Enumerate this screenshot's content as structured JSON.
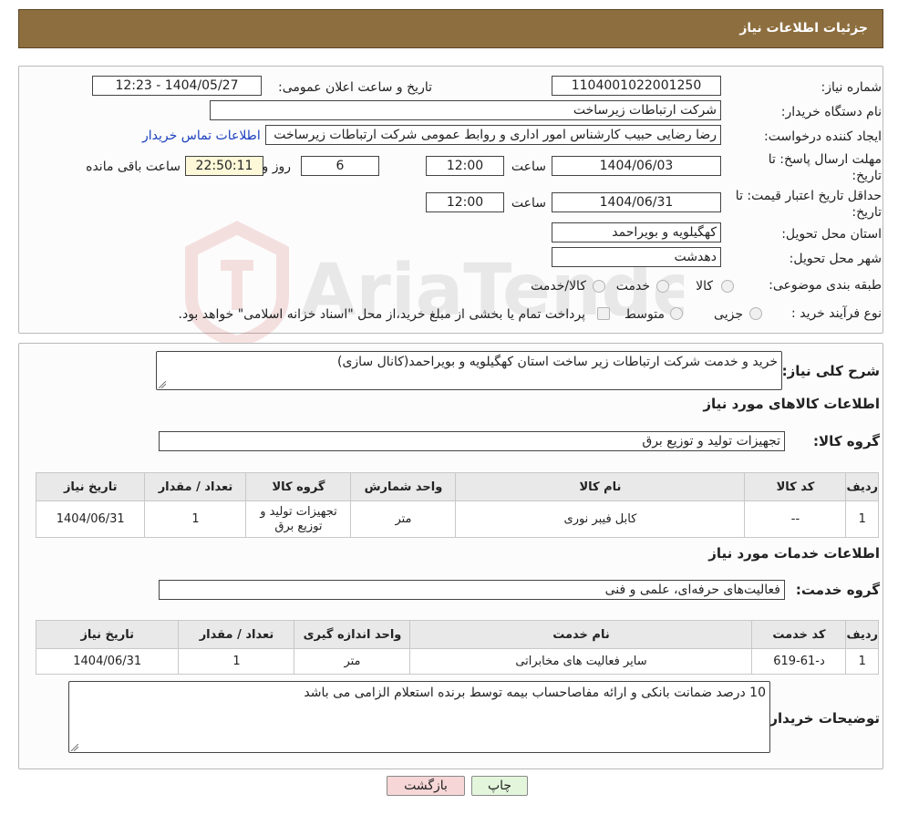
{
  "header": {
    "title": "جزئیات اطلاعات نیاز"
  },
  "watermark": {
    "text": "AriaTender.neT"
  },
  "fields": {
    "need_number_label": "شماره نیاز:",
    "need_number": "1104001022001250",
    "announce_label": "تاریخ و ساعت اعلان عمومی:",
    "announce_value": "1404/05/27 - 12:23",
    "buyer_org_label": "نام دستگاه خریدار:",
    "buyer_org": "شرکت ارتباطات زیرساخت",
    "creator_label": "ایجاد کننده درخواست:",
    "creator": "رضا رضایی حبیب کارشناس امور اداری و روابط عمومی شرکت ارتباطات زیرساخت",
    "contact_link": "اطلاعات تماس خریدار",
    "deadline_label_1": "مهلت ارسال پاسخ: تا",
    "deadline_label_2": "تاریخ:",
    "deadline_date": "1404/06/03",
    "time_label": "ساعت",
    "deadline_time": "12:00",
    "days_value": "6",
    "days_label": "روز و",
    "remaining_time": "22:50:11",
    "remaining_label": "ساعت باقی مانده",
    "validity_label_1": "حداقل تاریخ اعتبار قیمت: تا",
    "validity_label_2": "تاریخ:",
    "validity_date": "1404/06/31",
    "validity_time": "12:00",
    "province_label": "استان محل تحویل:",
    "province": "کهگیلویه و بویراحمد",
    "city_label": "شهر محل تحویل:",
    "city": "دهدشت",
    "category_label": "طبقه بندی موضوعی:",
    "category_options": [
      "کالا",
      "خدمت",
      "کالا/خدمت"
    ],
    "process_label": "نوع فرآیند خرید :",
    "process_options": [
      "جزیی",
      "متوسط"
    ],
    "process_note": "پرداخت تمام یا بخشی از مبلغ خرید،از محل \"اسناد خزانه اسلامی\" خواهد بود."
  },
  "summary": {
    "label": "شرح کلی نیاز:",
    "text": "خرید و خدمت شرکت ارتباطات زیر ساخت استان کهگیلویه و بویراحمد(کانال سازی)"
  },
  "goods": {
    "section_title": "اطلاعات کالاهای مورد نیاز",
    "group_label": "گروه کالا:",
    "group_value": "تجهیزات تولید و توزیع برق",
    "columns": [
      "ردیف",
      "کد کالا",
      "نام کالا",
      "واحد شمارش",
      "گروه کالا",
      "تعداد / مقدار",
      "تاریخ نیاز"
    ],
    "rows": [
      {
        "row": "1",
        "code": "--",
        "name": "کابل فیبر نوری",
        "unit": "متر",
        "group": "تجهیزات تولید و توزیع برق",
        "qty": "1",
        "date": "1404/06/31"
      }
    ]
  },
  "services": {
    "section_title": "اطلاعات خدمات مورد نیاز",
    "group_label": "گروه خدمت:",
    "group_value": "فعالیت‌های حرفه‌ای، علمی و فنی",
    "columns": [
      "ردیف",
      "کد خدمت",
      "نام خدمت",
      "واحد اندازه گیری",
      "تعداد / مقدار",
      "تاریخ نیاز"
    ],
    "rows": [
      {
        "row": "1",
        "code": "د-61-619",
        "name": "سایر فعالیت های مخابراتی",
        "unit": "متر",
        "qty": "1",
        "date": "1404/06/31"
      }
    ]
  },
  "buyer_notes": {
    "label": "توضیحات خریدار:",
    "text": "10 درصد ضمانت بانکی و ارائه مفاصاحساب  بیمه توسط برنده استعلام الزامی می باشد"
  },
  "buttons": {
    "print": "چاپ",
    "back": "بازگشت"
  },
  "colors": {
    "title_bar": "#8d6e3f",
    "link": "#1b3fbf",
    "back_button": "#f6d6d6",
    "print_button": "#e3f6dc"
  }
}
